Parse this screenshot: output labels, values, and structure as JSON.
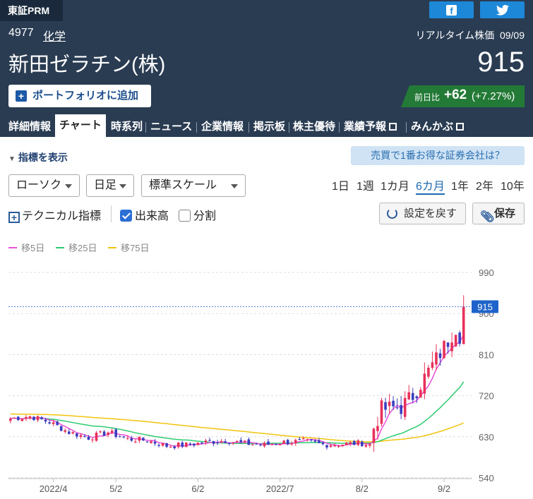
{
  "header": {
    "market": "東証PRM",
    "social": {
      "facebook_icon": "f",
      "twitter_icon": "twitter-bird-icon"
    },
    "code": "4977",
    "industry": "化学",
    "realtime_label": "リアルタイム株価",
    "date": "09/09",
    "name": "新田ゼラチン(株)",
    "price": "915",
    "portfolio_button": "ポートフォリオに追加",
    "change_label": "前日比",
    "change_value": "+62",
    "change_pct": "(+7.27%)"
  },
  "tabs": [
    "詳細情報",
    "チャート",
    "時系列",
    "ニュース",
    "企業情報",
    "掲示板",
    "株主優待",
    "業績予報",
    "みんかぶ"
  ],
  "active_tab": "チャート",
  "controls": {
    "indicator_toggle": "指標を表示",
    "broker_link": "売買で1番お得な証券会社は？",
    "chart_type": "ローソク",
    "interval": "日足",
    "scale": "標準スケール",
    "periods": [
      "1日",
      "1週",
      "1カ月",
      "6カ月",
      "1年",
      "2年",
      "10年"
    ],
    "active_period": "6カ月",
    "technical": "テクニカル指標",
    "volume": "出来高",
    "volume_checked": true,
    "split": "分割",
    "split_checked": false,
    "reset": "設定を戻す",
    "save": "保存"
  },
  "legend": [
    {
      "label": "移5日",
      "color": "#e84fd8"
    },
    {
      "label": "移25日",
      "color": "#2ecc71"
    },
    {
      "label": "移75日",
      "color": "#f1c40f"
    }
  ],
  "chart_data": {
    "type": "candlestick",
    "y_ticks": [
      990,
      900,
      810,
      720,
      630,
      540
    ],
    "ylim": [
      540,
      1010
    ],
    "x_ticks": [
      {
        "label": "2022/4",
        "index": 11
      },
      {
        "label": "5/2",
        "index": 27
      },
      {
        "label": "6/2",
        "index": 48
      },
      {
        "label": "2022/7",
        "index": 69
      },
      {
        "label": "8/2",
        "index": 90
      },
      {
        "label": "9/2",
        "index": 111
      }
    ],
    "current_price": 915,
    "up_color": "#e8315b",
    "down_color": "#3a3dbf",
    "anchors": [
      [
        0,
        670
      ],
      [
        5,
        675
      ],
      [
        10,
        662
      ],
      [
        15,
        640
      ],
      [
        20,
        628
      ],
      [
        25,
        640
      ],
      [
        30,
        625
      ],
      [
        35,
        622
      ],
      [
        40,
        610
      ],
      [
        45,
        612
      ],
      [
        50,
        618
      ],
      [
        55,
        622
      ],
      [
        60,
        615
      ],
      [
        65,
        612
      ],
      [
        70,
        618
      ],
      [
        75,
        620
      ],
      [
        80,
        613
      ],
      [
        85,
        614
      ],
      [
        90,
        616
      ],
      [
        92,
        612
      ],
      [
        93,
        650
      ],
      [
        95,
        690
      ],
      [
        100,
        695
      ],
      [
        103,
        720
      ],
      [
        106,
        760
      ],
      [
        109,
        800
      ],
      [
        112,
        840
      ],
      [
        114,
        870
      ],
      [
        115,
        853
      ],
      [
        116,
        915
      ]
    ],
    "ma_series": [
      {
        "name": "移5日",
        "color": "#e84fd8",
        "period": 5
      },
      {
        "name": "移25日",
        "color": "#2ecc71",
        "period": 25
      },
      {
        "name": "移75日",
        "color": "#f1c40f",
        "period": 75
      }
    ]
  }
}
